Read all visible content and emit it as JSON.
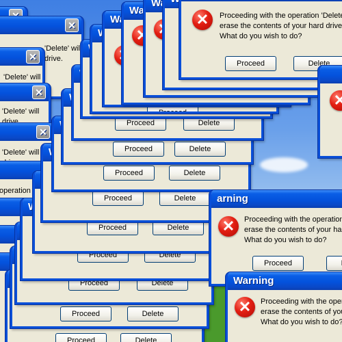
{
  "dialog": {
    "title": "Warning",
    "title_partial_1": "Warn",
    "title_partial_2": "Wa",
    "title_partial_3": "W",
    "title_partial_4": "arning",
    "message_line1": "Proceeding with the operation 'Delete' will",
    "message_line2": "erase the contents of your hard drive.",
    "message_line3": "What do you wish to do?",
    "message_trunc_line2": "erase the contents of your hard d",
    "left_line1": "'Delete' will",
    "left_line2": "drive.",
    "left_line3": "operation 'Delete' will",
    "proceed_label": "Proceed",
    "delete_label": "Delete"
  },
  "icons": {
    "error": "error-x-icon",
    "close": "close-x-icon"
  },
  "colors": {
    "titlebar": "#0452dc",
    "window_bg": "#ece9d8",
    "error_red": "#e21e12"
  }
}
